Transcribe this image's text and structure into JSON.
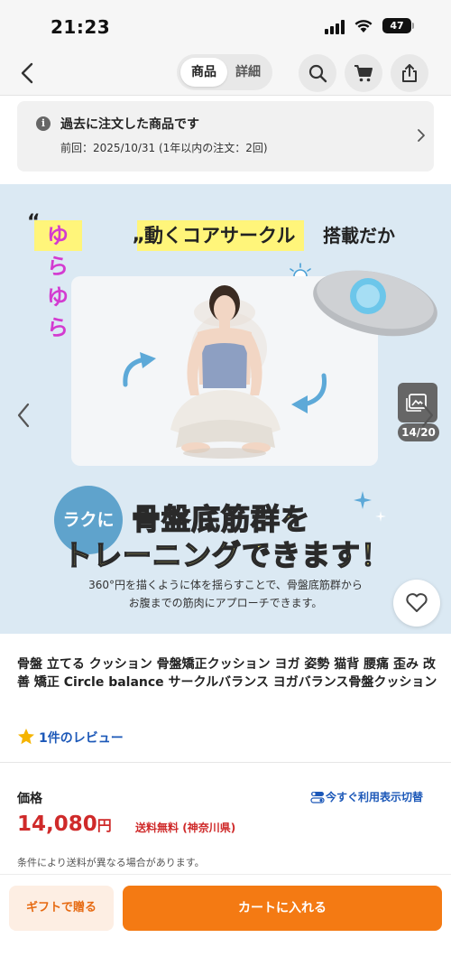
{
  "status_bar": {
    "time": "21:23",
    "battery": "47"
  },
  "nav": {
    "segments": [
      "商品",
      "詳細"
    ],
    "icons": [
      "back-icon",
      "search-icon",
      "cart-icon",
      "share-icon"
    ]
  },
  "previous_order": {
    "title": "過去に注文した商品です",
    "detail": "前回：2025/10/31 (1年以内の注文：2回)"
  },
  "hero": {
    "quote_open": "“",
    "quote_close": "”",
    "highlight": "ゆらゆら",
    "headline": "動くコアサークル",
    "headline_tail": "搭載だか",
    "counter": "14/20",
    "badge": "ラクに",
    "big_line1": "骨盤底筋群を",
    "big_line2": "トレーニングできます！",
    "desc_line1": "360°円を描くように体を揺らすことで、骨盤底筋群から",
    "desc_line2": "お腹までの筋肉にアプローチできます。",
    "colors": {
      "background": "#dbe9f3",
      "highlight": "#fff57a",
      "badge": "#5fa3cc"
    }
  },
  "product": {
    "title": "骨盤 立てる クッション 骨盤矯正クッション ヨガ 姿勢 猫背 腰痛 歪み 改善 矯正 Circle balance サークルバランス ヨガバランス骨盤クッション",
    "review_text": "1件のレビュー"
  },
  "pricing": {
    "label": "価格",
    "switch_link": "今すぐ利用表示切替",
    "price": "14,080",
    "currency": "円",
    "shipping": "送料無料",
    "region": "(神奈川県)",
    "note": "条件により送料が異なる場合があります。",
    "colors": {
      "price": "#cf2a2a",
      "link": "#1c58b8"
    }
  },
  "actions": {
    "gift": "ギフトで贈る",
    "cart": "カートに入れる",
    "colors": {
      "cart": "#f47a13",
      "gift_bg": "#fdeee3"
    }
  }
}
